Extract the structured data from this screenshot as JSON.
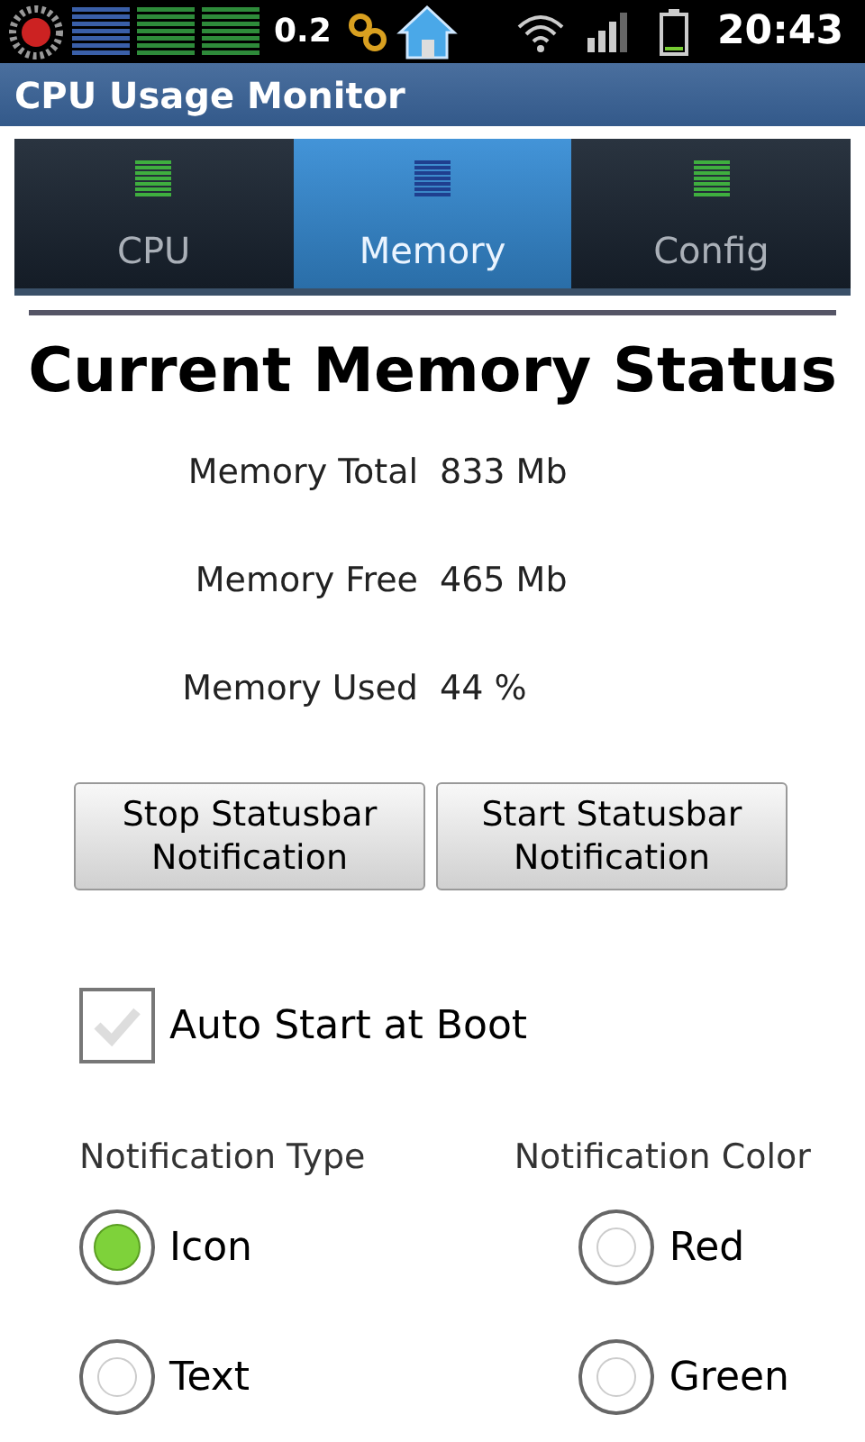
{
  "status_bar": {
    "load": "0.2",
    "time": "20:43"
  },
  "title_bar": {
    "title": "CPU Usage Monitor"
  },
  "tabs": [
    {
      "label": "CPU",
      "selected": false,
      "color": "#3fae3f"
    },
    {
      "label": "Memory",
      "selected": true,
      "color": "#1f3f8f"
    },
    {
      "label": "Config",
      "selected": false,
      "color": "#3fae3f"
    }
  ],
  "heading": "Current Memory Status",
  "stats": [
    {
      "label": "Memory Total",
      "value": "833 Mb"
    },
    {
      "label": "Memory Free",
      "value": "465 Mb"
    },
    {
      "label": "Memory Used",
      "value": "44 %"
    }
  ],
  "buttons": [
    {
      "label": "Stop Statusbar Notification"
    },
    {
      "label": "Start Statusbar Notification"
    }
  ],
  "auto_start": {
    "label": "Auto Start at Boot",
    "checked": false
  },
  "notification_type": {
    "label": "Notification Type",
    "options": [
      {
        "label": "Icon",
        "selected": true
      },
      {
        "label": "Text",
        "selected": false
      }
    ]
  },
  "notification_color": {
    "label": "Notification Color",
    "options": [
      {
        "label": "Red",
        "selected": false
      },
      {
        "label": "Green",
        "selected": false
      }
    ]
  }
}
